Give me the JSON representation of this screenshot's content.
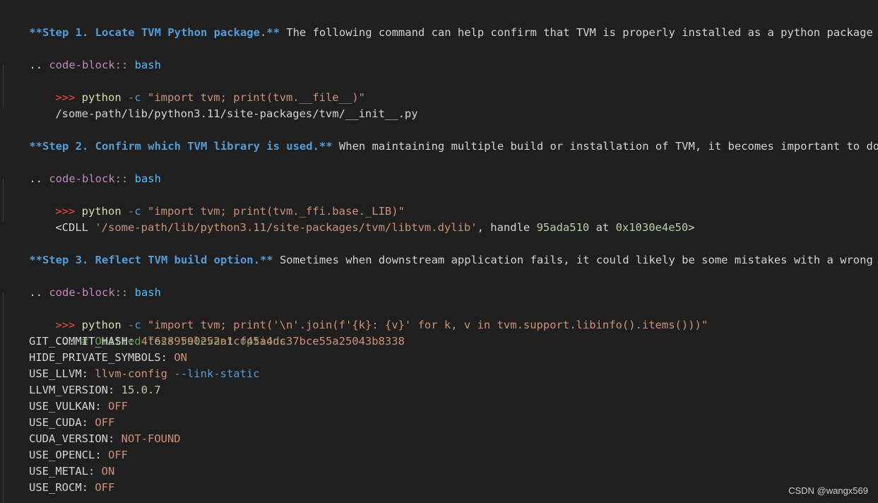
{
  "steps": [
    {
      "heading": "**Step 1. Locate TVM Python package.**",
      "text": " The following command can help confirm that TVM is properly installed as a python package and",
      "directive_dots": ".. ",
      "directive": "code-block::",
      "language": " bash",
      "prompt": ">>> ",
      "command": "python",
      "flag": " -c ",
      "argument": "\"import tvm; print(tvm.__file__)\"",
      "output": "/some-path/lib/python3.11/site-packages/tvm/__init__.py"
    },
    {
      "heading": "**Step 2. Confirm which TVM library is used.**",
      "text": " When maintaining multiple build or installation of TVM, it becomes important to double",
      "directive_dots": ".. ",
      "directive": "code-block::",
      "language": " bash",
      "prompt": ">>> ",
      "command": "python",
      "flag": " -c ",
      "argument": "\"import tvm; print(tvm._ffi.base._LIB)\"",
      "output_prefix": "<CDLL ",
      "output_path": "'/some-path/lib/python3.11/site-packages/tvm/libtvm.dylib'",
      "output_handle_label": ", handle ",
      "output_handle": "95ada510",
      "output_at": " at ",
      "output_addr": "0x1030e4e50",
      "output_suffix": ">"
    },
    {
      "heading": "**Step 3. Reflect TVM build option.**",
      "text": " Sometimes when downstream application fails, it could likely be some mistakes with a wrong TVM",
      "directive_dots": ".. ",
      "directive": "code-block::",
      "language": " bash",
      "prompt": ">>> ",
      "command": "python",
      "flag": " -c ",
      "argument": "\"import tvm; print('\\n'.join(f'{k}: {v}' for k, v in tvm.support.libinfo().items()))\"",
      "ellipsis": "... ",
      "comment": "# Omitted less relevant options",
      "options": [
        {
          "key": "GIT_COMMIT_HASH",
          "value": "4f6289590252a1cf45a4dc37bce55a25043b8338",
          "kind": "str"
        },
        {
          "key": "HIDE_PRIVATE_SYMBOLS",
          "value": "ON",
          "kind": "str"
        },
        {
          "key": "USE_LLVM",
          "value": "llvm-config",
          "extra": " --link-static",
          "kind": "str"
        },
        {
          "key": "LLVM_VERSION",
          "value": "15.0.7",
          "kind": "num"
        },
        {
          "key": "USE_VULKAN",
          "value": "OFF",
          "kind": "str"
        },
        {
          "key": "USE_CUDA",
          "value": "OFF",
          "kind": "str"
        },
        {
          "key": "CUDA_VERSION",
          "value": "NOT-FOUND",
          "kind": "str"
        },
        {
          "key": "USE_OPENCL",
          "value": "OFF",
          "kind": "str"
        },
        {
          "key": "USE_METAL",
          "value": "ON",
          "kind": "str"
        },
        {
          "key": "USE_ROCM",
          "value": "OFF",
          "kind": "str"
        }
      ]
    }
  ],
  "watermark": "CSDN @wangx569",
  "colors": {
    "background": "#1f1f1f",
    "heading": "#569cd6",
    "directive": "#c586c0",
    "string": "#ce9178",
    "number": "#b5cea8",
    "comment": "#6a9955",
    "function": "#dcdcaa"
  }
}
